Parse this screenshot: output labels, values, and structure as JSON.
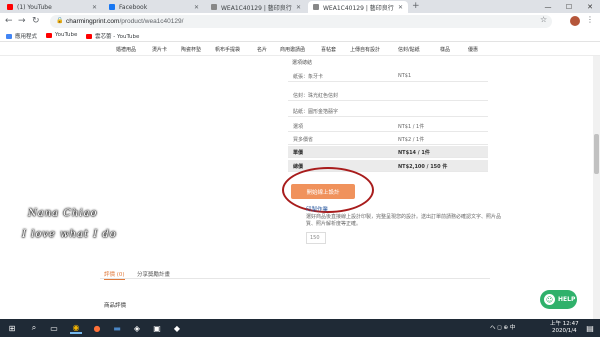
{
  "browser": {
    "tabs": [
      {
        "title": "(1) YouTube",
        "icon_color": "#ff0000"
      },
      {
        "title": "Facebook",
        "icon_color": "#1877f2"
      },
      {
        "title": "WEA1C40129 | 藝印良行",
        "icon_color": "#888888"
      },
      {
        "title": "WEA1C40129 | 藝印良行",
        "icon_color": "#888888"
      }
    ],
    "new_tab": "+",
    "window_controls": {
      "minimize": "—",
      "maximize": "☐",
      "close": "✕"
    },
    "url_host": "charmingprint.com",
    "url_path": "/product/wea1c40129/",
    "bookmarks": [
      {
        "label": "應用程式",
        "icon_color": "#4285f4"
      },
      {
        "label": "YouTube",
        "icon_color": "#ff0000"
      },
      {
        "label": "雲芯蕾 - YouTube",
        "icon_color": "#ff0000"
      }
    ]
  },
  "site_nav": [
    "婚禮用品",
    "燙片卡",
    "陶瓷杯墊",
    "帆布手提袋",
    "名片",
    "商用邀請函",
    "喜帖套",
    "上傳自有設計",
    "信封/貼紙",
    "樣品",
    "優惠"
  ],
  "options": {
    "heading": "選項總結",
    "rows": [
      {
        "key": "紙張：象牙卡",
        "value": "NT$1"
      },
      {
        "key": "信封：珠光紅色信封",
        "value": ""
      },
      {
        "key": "貼紙：圓形金箔囍字",
        "value": ""
      },
      {
        "key": "選項",
        "value": "NT$1 / 1件"
      },
      {
        "key": "買多價省",
        "value": "NT$2 / 1件"
      },
      {
        "key": "單價",
        "value": "NT$14 / 1件"
      },
      {
        "key": "總價",
        "value": "NT$2,100 / 150 件"
      }
    ]
  },
  "upload_button": "開始線上設計",
  "print_section": {
    "title": "印製作業",
    "description": "選好商品後直接線上設計印製，完整呈現您的設計。送出訂單前請務必確認文字、照片品質、照片解析度等正確。"
  },
  "quantity": "150",
  "signature": {
    "line1": "Nana Chiao",
    "line2": "I love what I do"
  },
  "tabs": {
    "reviews": "評價 (0)",
    "share": "分享獎勵計畫"
  },
  "product_reviews": "商品評價",
  "help": {
    "label": "HELP"
  },
  "taskbar": {
    "time": "上午 12:47",
    "date": "2020/1/4",
    "tray_text": "へ ◻ ⊕ 中"
  },
  "colors": {
    "accent_orange": "#f0925c",
    "annotation_red": "#a81c1c",
    "help_green": "#2fb16b"
  }
}
